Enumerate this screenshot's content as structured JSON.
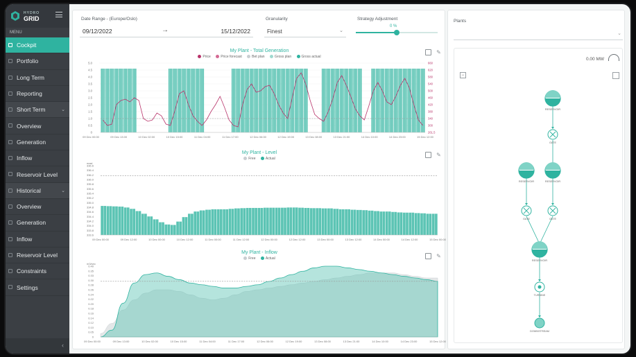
{
  "brand": {
    "line1": "HYDRO",
    "line2": "GRID"
  },
  "sidebar": {
    "caption": "MENU",
    "items": [
      {
        "label": "Cockpit",
        "active": true
      },
      {
        "label": "Portfolio"
      },
      {
        "label": "Long Term"
      },
      {
        "label": "Reporting"
      },
      {
        "label": "Short Term",
        "section": true
      },
      {
        "label": "Overview"
      },
      {
        "label": "Generation"
      },
      {
        "label": "Inflow"
      },
      {
        "label": "Reservoir Level"
      },
      {
        "label": "Historical",
        "section": true
      },
      {
        "label": "Overview"
      },
      {
        "label": "Generation"
      },
      {
        "label": "Inflow"
      },
      {
        "label": "Reservoir Level"
      },
      {
        "label": "Constraints"
      },
      {
        "label": "Settings"
      }
    ],
    "collapse_icon": "chevron-left-icon"
  },
  "controls": {
    "date_range_label": "Date Range - (Europe/Oslo)",
    "date_from": "09/12/2022",
    "date_to": "15/12/2022",
    "granularity_label": "Granularity",
    "granularity_value": "Finest",
    "strategy_label": "Strategy Adjustment",
    "strategy_value": "0 %",
    "strategy_fraction": 0.5,
    "plants_label": "Plants",
    "plants_value": ""
  },
  "colors": {
    "accent": "#2fb3a0",
    "price": "#b8336a",
    "sidebar": "#3b3f44"
  },
  "diagram": {
    "mw_readout": "0.00 MW",
    "nodes": [
      "RESERVOIR",
      "GATE",
      "RESERVOIR",
      "RESERVOIR",
      "GATE",
      "GATE",
      "RESERVOIR",
      "TURBINE",
      "DOWNSTREAM"
    ]
  },
  "chart_data": [
    {
      "type": "bar",
      "title": "My Plant - Total Generation",
      "legend": [
        "Price",
        "Price forecast",
        "Bet plan",
        "Gross plan",
        "Gross actual"
      ],
      "ylabel": "",
      "y2label": "",
      "ylim": [
        0,
        5
      ],
      "y_ticks": [
        "5.0",
        "4.5",
        "4.0",
        "3.5",
        "3.0",
        "2.5",
        "2.0",
        "1.5",
        "1.0",
        "0.5",
        "0"
      ],
      "y2_ticks": [
        "660",
        "620",
        "580",
        "540",
        "500",
        "460",
        "420",
        "380",
        "340",
        "300",
        "261.5"
      ],
      "x_ticks": [
        "09 Dec 00:00",
        "09 Dec 13:00",
        "10 Dec 02:00",
        "10 Dec 15:00",
        "11 Dec 04:00",
        "11 Dec 17:00",
        "12 Dec 06:00",
        "12 Dec 19:00",
        "13 Dec 08:00",
        "13 Dec 21:00",
        "14 Dec 10:00",
        "14 Dec 23:00",
        "15 Dec 12:00"
      ],
      "generation_bars": [
        4.6,
        4.6,
        4.6,
        4.6,
        4.6,
        4.6,
        4.6,
        4.6,
        0,
        0,
        0,
        0,
        0,
        0,
        0,
        4.6,
        4.6,
        4.6,
        4.6,
        4.6,
        4.6,
        4.6,
        4.6,
        0,
        0,
        0,
        0,
        0,
        0,
        4.6,
        4.6,
        4.6,
        4.6,
        4.6,
        4.6,
        4.6,
        4.6,
        4.6,
        4.6,
        4.6,
        4.6,
        4.6,
        4.6,
        4.6,
        4.6,
        4.6,
        0,
        0,
        0,
        4.6,
        4.6,
        4.6,
        4.6,
        4.6,
        4.6,
        4.6,
        4.6,
        4.6,
        0,
        0,
        4.6,
        4.6,
        4.6,
        4.6,
        4.6,
        4.6,
        4.6,
        4.6,
        4.6,
        4.6,
        4.6,
        4.6
      ],
      "price_line": [
        0.9,
        0.5,
        0.6,
        2.0,
        2.3,
        2.4,
        2.2,
        2.5,
        2.3,
        1.0,
        0.8,
        0.9,
        1.4,
        1.2,
        0.6,
        0.5,
        1.6,
        2.8,
        3.0,
        2.0,
        1.2,
        0.8,
        0.5,
        0.9,
        1.5,
        2.0,
        2.6,
        1.8,
        0.9,
        0.5,
        0.4,
        2.0,
        3.1,
        3.5,
        2.9,
        3.0,
        3.3,
        3.4,
        2.8,
        2.0,
        1.4,
        1.0,
        2.5,
        3.9,
        4.3,
        3.5,
        2.3,
        1.3,
        1.0,
        0.8,
        1.5,
        2.4,
        3.6,
        4.1,
        3.4,
        2.6,
        1.7,
        1.2,
        0.9,
        1.9,
        3.0,
        3.6,
        3.0,
        2.2,
        2.0,
        2.6,
        3.4,
        3.9,
        3.2,
        2.0,
        0.9,
        0.5
      ],
      "reference_line": 1.0
    },
    {
      "type": "bar",
      "title": "My Plant - Level",
      "legend": [
        "Free",
        "Actual"
      ],
      "ylabel": "masl",
      "ylim": [
        333.0,
        336.5
      ],
      "y_ticks": [
        "336.6",
        "336.4",
        "336.2",
        "336.0",
        "335.8",
        "335.6",
        "335.4",
        "335.2",
        "335.0",
        "334.8",
        "334.6",
        "334.4",
        "334.2",
        "334.0",
        "333.8",
        "333.6"
      ],
      "x_ticks": [
        "09 Dec 00:00",
        "09 Dec 12:00",
        "10 Dec 00:00",
        "10 Dec 12:00",
        "11 Dec 00:00",
        "11 Dec 12:00",
        "12 Dec 00:00",
        "12 Dec 12:00",
        "13 Dec 00:00",
        "13 Dec 12:00",
        "14 Dec 00:00",
        "14 Dec 12:00",
        "15 Dec 00:00"
      ],
      "level_bars": [
        334.85,
        334.84,
        334.83,
        334.82,
        334.78,
        334.72,
        334.62,
        334.5,
        334.38,
        334.25,
        334.12,
        334.02,
        334.0,
        334.15,
        334.35,
        334.5,
        334.6,
        334.65,
        334.68,
        334.7,
        334.7,
        334.7,
        334.72,
        334.74,
        334.75,
        334.76,
        334.76,
        334.76,
        334.77,
        334.77,
        334.77,
        334.77,
        334.78,
        334.78,
        334.77,
        334.76,
        334.75,
        334.75,
        334.74,
        334.74,
        334.72,
        334.7,
        334.7,
        334.68,
        334.67,
        334.66,
        334.64,
        334.62,
        334.6,
        334.6,
        334.58,
        334.56,
        334.55,
        334.55,
        334.53,
        334.52,
        334.5,
        334.5
      ],
      "reference_line": 336.2
    },
    {
      "type": "area",
      "title": "My Plant - Inflow",
      "legend": [
        "Free",
        "Actual"
      ],
      "ylabel": "m3/sec",
      "ylim": [
        0,
        0.45
      ],
      "y_ticks": [
        "0.40",
        "0.35",
        "0.33",
        "0.30",
        "0.28",
        "0.26",
        "0.24",
        "0.22",
        "0.20",
        "0.18",
        "0.16",
        "0.14",
        "0.12",
        "0.10",
        "0.05",
        "0"
      ],
      "x_ticks": [
        "09 Dec 00:00",
        "09 Dec 13:00",
        "10 Dec 02:00",
        "10 Dec 15:00",
        "11 Dec 04:00",
        "11 Dec 17:00",
        "12 Dec 06:00",
        "12 Dec 19:00",
        "13 Dec 08:00",
        "13 Dec 21:00",
        "14 Dec 10:00",
        "14 Dec 23:00",
        "15 Dec 12:00"
      ],
      "series": [
        {
          "name": "Free",
          "values": [
            0.02,
            0.08,
            0.16,
            0.22,
            0.26,
            0.28,
            0.28,
            0.27,
            0.25,
            0.23,
            0.22,
            0.23,
            0.25,
            0.27,
            0.28,
            0.29,
            0.3,
            0.31,
            0.32,
            0.33,
            0.34,
            0.35,
            0.36,
            0.37,
            0.38,
            0.38,
            0.38,
            0.37,
            0.36,
            0.35,
            0.35
          ]
        },
        {
          "name": "Actual",
          "values": [
            0.0,
            0.04,
            0.2,
            0.32,
            0.37,
            0.38,
            0.36,
            0.34,
            0.32,
            0.31,
            0.3,
            0.29,
            0.29,
            0.3,
            0.31,
            0.33,
            0.35,
            0.37,
            0.39,
            0.41,
            0.42,
            0.42,
            0.41,
            0.4,
            0.39,
            0.38,
            0.37,
            0.36,
            0.35,
            0.34,
            0.33
          ]
        }
      ],
      "reference_line": 0.33
    }
  ]
}
